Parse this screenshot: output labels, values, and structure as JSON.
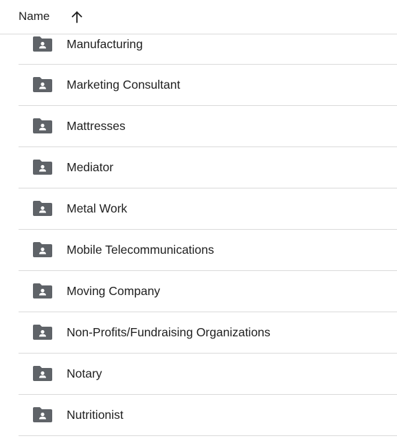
{
  "header": {
    "name_label": "Name",
    "sort_icon": "arrow-up-icon"
  },
  "items": [
    {
      "label": "Manufacturing",
      "icon": "shared-folder-icon"
    },
    {
      "label": "Marketing Consultant",
      "icon": "shared-folder-icon"
    },
    {
      "label": "Mattresses",
      "icon": "shared-folder-icon"
    },
    {
      "label": "Mediator",
      "icon": "shared-folder-icon"
    },
    {
      "label": "Metal Work",
      "icon": "shared-folder-icon"
    },
    {
      "label": "Mobile Telecommunications",
      "icon": "shared-folder-icon"
    },
    {
      "label": "Moving Company",
      "icon": "shared-folder-icon"
    },
    {
      "label": "Non-Profits/Fundraising Organizations",
      "icon": "shared-folder-icon"
    },
    {
      "label": "Notary",
      "icon": "shared-folder-icon"
    },
    {
      "label": "Nutritionist",
      "icon": "shared-folder-icon"
    }
  ],
  "colors": {
    "text": "#1f1f1f",
    "icon": "#5f6368",
    "divider": "#d9d9d9"
  }
}
